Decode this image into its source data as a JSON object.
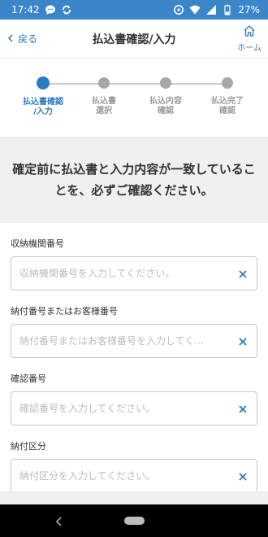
{
  "status_bar": {
    "time": "17:42",
    "battery": "27%"
  },
  "header": {
    "back_label": "戻る",
    "title": "払込書確認/入力",
    "home_label": "ホーム"
  },
  "stepper": {
    "steps": [
      {
        "label": "払込書確認\n/入力",
        "active": true
      },
      {
        "label": "払込書\n選択",
        "active": false
      },
      {
        "label": "払込内容\n確認",
        "active": false
      },
      {
        "label": "払込完了\n確認",
        "active": false
      }
    ]
  },
  "notice": {
    "text": "確定前に払込書と入力内容が一致していることを、必ずご確認ください。"
  },
  "form": {
    "fields": [
      {
        "label": "収納機関番号",
        "value": "",
        "placeholder": "収納機関番号を入力してください。"
      },
      {
        "label": "納付番号またはお客様番号",
        "value": "",
        "placeholder": "納付番号またはお客様番号を入力してく..."
      },
      {
        "label": "確認番号",
        "value": "",
        "placeholder": "確認番号を入力してください。"
      },
      {
        "label": "納付区分",
        "value": "",
        "placeholder": "納付区分を入力してください。"
      }
    ]
  },
  "colors": {
    "accent": "#2a7bc0",
    "status_bar": "#3b86c8",
    "notice_bg": "#f0f0f0"
  },
  "icons": [
    "chat-icon",
    "sync-icon",
    "alarm-icon",
    "wifi-icon",
    "signal-icon",
    "battery-icon",
    "chevron-left-icon",
    "home-icon",
    "clear-icon"
  ]
}
